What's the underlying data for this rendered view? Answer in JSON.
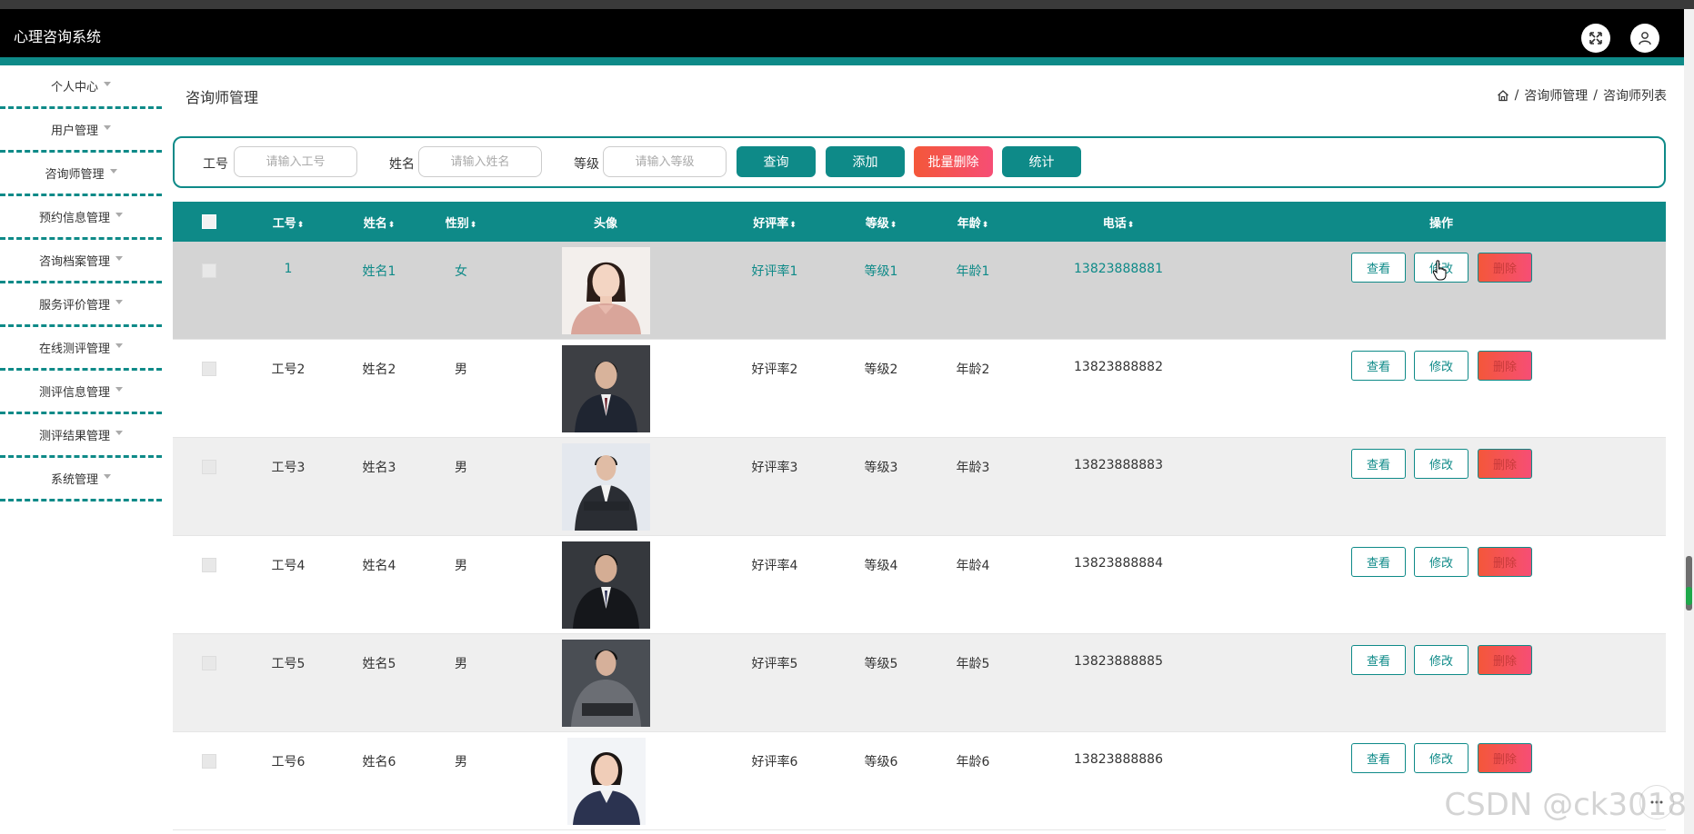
{
  "header": {
    "title": "心理咨询系统"
  },
  "sidebar": {
    "items": [
      {
        "label": "个人中心"
      },
      {
        "label": "用户管理"
      },
      {
        "label": "咨询师管理"
      },
      {
        "label": "预约信息管理"
      },
      {
        "label": "咨询档案管理"
      },
      {
        "label": "服务评价管理"
      },
      {
        "label": "在线测评管理"
      },
      {
        "label": "测评信息管理"
      },
      {
        "label": "测评结果管理"
      },
      {
        "label": "系统管理"
      }
    ]
  },
  "page": {
    "title": "咨询师管理",
    "breadcrumb": [
      "咨询师管理",
      "咨询师列表"
    ]
  },
  "search": {
    "gonghao_label": "工号",
    "gonghao_placeholder": "请输入工号",
    "xingming_label": "姓名",
    "xingming_placeholder": "请输入姓名",
    "dengji_label": "等级",
    "dengji_placeholder": "请输入等级",
    "query_label": "查询",
    "add_label": "添加",
    "batch_delete_label": "批量删除",
    "stats_label": "统计"
  },
  "table": {
    "columns": [
      "工号",
      "姓名",
      "性别",
      "头像",
      "好评率",
      "等级",
      "年龄",
      "电话",
      "操作"
    ],
    "action_labels": {
      "view": "查看",
      "edit": "修改",
      "delete": "删除"
    },
    "rows": [
      {
        "gonghao": "1",
        "xingming": "姓名1",
        "xingbie": "女",
        "haopinglv": "好评率1",
        "dengji": "等级1",
        "nianling": "年龄1",
        "dianhua": "13823888881"
      },
      {
        "gonghao": "工号2",
        "xingming": "姓名2",
        "xingbie": "男",
        "haopinglv": "好评率2",
        "dengji": "等级2",
        "nianling": "年龄2",
        "dianhua": "13823888882"
      },
      {
        "gonghao": "工号3",
        "xingming": "姓名3",
        "xingbie": "男",
        "haopinglv": "好评率3",
        "dengji": "等级3",
        "nianling": "年龄3",
        "dianhua": "13823888883"
      },
      {
        "gonghao": "工号4",
        "xingming": "姓名4",
        "xingbie": "男",
        "haopinglv": "好评率4",
        "dengji": "等级4",
        "nianling": "年龄4",
        "dianhua": "13823888884"
      },
      {
        "gonghao": "工号5",
        "xingming": "姓名5",
        "xingbie": "男",
        "haopinglv": "好评率5",
        "dengji": "等级5",
        "nianling": "年龄5",
        "dianhua": "13823888885"
      },
      {
        "gonghao": "工号6",
        "xingming": "姓名6",
        "xingbie": "男",
        "haopinglv": "好评率6",
        "dengji": "等级6",
        "nianling": "年龄6",
        "dianhua": "13823888886"
      }
    ]
  },
  "watermark": "CSDN @ck3018",
  "colors": {
    "primary": "#0e8a88",
    "danger": "#f4573a",
    "header": "#000000"
  }
}
